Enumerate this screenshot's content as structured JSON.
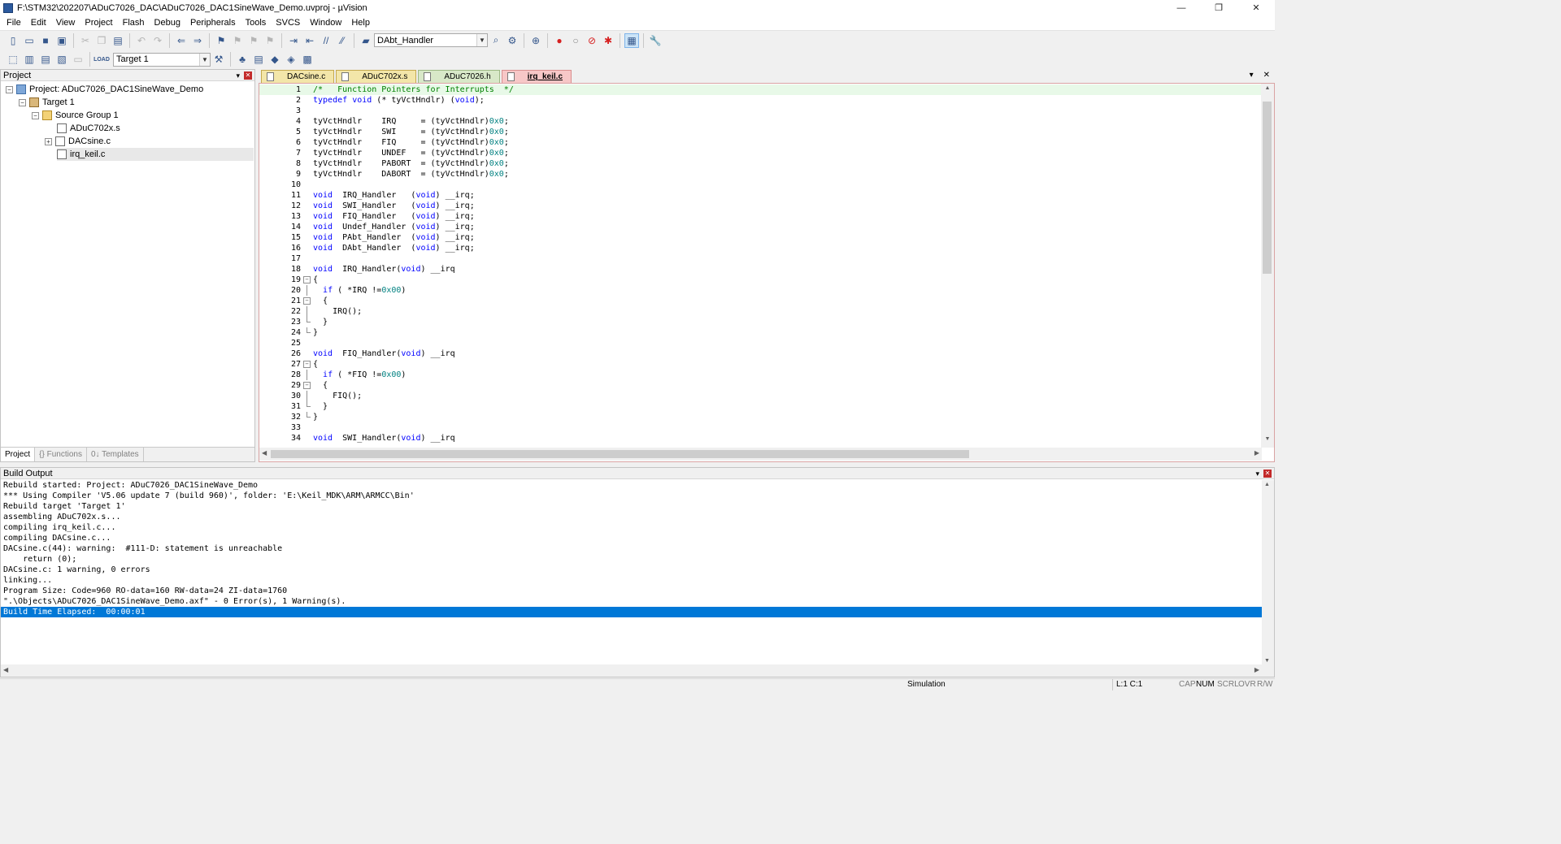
{
  "window": {
    "title": "F:\\STM32\\202207\\ADuC7026_DAC\\ADuC7026_DAC1SineWave_Demo.uvproj - µVision",
    "minimize": "—",
    "restore": "❐",
    "close": "✕"
  },
  "menu": [
    "File",
    "Edit",
    "View",
    "Project",
    "Flash",
    "Debug",
    "Peripherals",
    "Tools",
    "SVCS",
    "Window",
    "Help"
  ],
  "toolbar": {
    "function_combo": "DAbt_Handler",
    "target_combo": "Target 1",
    "load_label": "LOAD"
  },
  "project_panel": {
    "title": "Project",
    "pin": "▾",
    "close": "✕",
    "tree": [
      {
        "label": "Project: ADuC7026_DAC1SineWave_Demo",
        "icon": "project-icon",
        "expander": "−"
      },
      {
        "label": "Target 1",
        "icon": "target-icon",
        "expander": "−"
      },
      {
        "label": "Source Group 1",
        "icon": "folder-icon",
        "expander": "−"
      },
      {
        "label": "ADuC702x.s",
        "icon": "file-icon"
      },
      {
        "label": "DACsine.c",
        "icon": "file-icon",
        "expander": "+"
      },
      {
        "label": "irq_keil.c",
        "icon": "file-icon"
      }
    ],
    "tabs": [
      "Project",
      "{} Functions",
      "0↓ Templates"
    ]
  },
  "editor": {
    "tabs": [
      "DACsine.c",
      "ADuC702x.s",
      "ADuC7026.h",
      "irq_keil.c"
    ],
    "active_tab": "irq_keil.c",
    "tab_menu": "▾",
    "tab_close": "✕",
    "lines": [
      {
        "n": "1",
        "t": "/*   Function Pointers for Interrupts  */"
      },
      {
        "n": "2",
        "t": "typedef void (* tyVctHndlr) (void);"
      },
      {
        "n": "3",
        "t": ""
      },
      {
        "n": "4",
        "t": "tyVctHndlr    IRQ     = (tyVctHndlr)0x0;"
      },
      {
        "n": "5",
        "t": "tyVctHndlr    SWI     = (tyVctHndlr)0x0;"
      },
      {
        "n": "6",
        "t": "tyVctHndlr    FIQ     = (tyVctHndlr)0x0;"
      },
      {
        "n": "7",
        "t": "tyVctHndlr    UNDEF   = (tyVctHndlr)0x0;"
      },
      {
        "n": "8",
        "t": "tyVctHndlr    PABORT  = (tyVctHndlr)0x0;"
      },
      {
        "n": "9",
        "t": "tyVctHndlr    DABORT  = (tyVctHndlr)0x0;"
      },
      {
        "n": "10",
        "t": ""
      },
      {
        "n": "11",
        "t": "void  IRQ_Handler   (void) __irq;"
      },
      {
        "n": "12",
        "t": "void  SWI_Handler   (void) __irq;"
      },
      {
        "n": "13",
        "t": "void  FIQ_Handler   (void) __irq;"
      },
      {
        "n": "14",
        "t": "void  Undef_Handler (void) __irq;"
      },
      {
        "n": "15",
        "t": "void  PAbt_Handler  (void) __irq;"
      },
      {
        "n": "16",
        "t": "void  DAbt_Handler  (void) __irq;"
      },
      {
        "n": "17",
        "t": ""
      },
      {
        "n": "18",
        "t": "void  IRQ_Handler(void) __irq"
      },
      {
        "n": "19",
        "t": "{"
      },
      {
        "n": "20",
        "t": "  if ( *IRQ !=0x00)"
      },
      {
        "n": "21",
        "t": "  {"
      },
      {
        "n": "22",
        "t": "    IRQ();"
      },
      {
        "n": "23",
        "t": "  }"
      },
      {
        "n": "24",
        "t": "}"
      },
      {
        "n": "25",
        "t": ""
      },
      {
        "n": "26",
        "t": "void  FIQ_Handler(void) __irq"
      },
      {
        "n": "27",
        "t": "{"
      },
      {
        "n": "28",
        "t": "  if ( *FIQ !=0x00)"
      },
      {
        "n": "29",
        "t": "  {"
      },
      {
        "n": "30",
        "t": "    FIQ();"
      },
      {
        "n": "31",
        "t": "  }"
      },
      {
        "n": "32",
        "t": "}"
      },
      {
        "n": "33",
        "t": ""
      },
      {
        "n": "34",
        "t": "void  SWI_Handler(void) __irq"
      }
    ]
  },
  "build_output": {
    "title": "Build Output",
    "pin": "▾",
    "close": "✕",
    "lines": [
      "Rebuild started: Project: ADuC7026_DAC1SineWave_Demo",
      "*** Using Compiler 'V5.06 update 7 (build 960)', folder: 'E:\\Keil_MDK\\ARM\\ARMCC\\Bin'",
      "Rebuild target 'Target 1'",
      "assembling ADuC702x.s...",
      "compiling irq_keil.c...",
      "compiling DACsine.c...",
      "DACsine.c(44): warning:  #111-D: statement is unreachable",
      "    return (0);",
      "DACsine.c: 1 warning, 0 errors",
      "linking...",
      "Program Size: Code=960 RO-data=160 RW-data=24 ZI-data=1760",
      "\".\\Objects\\ADuC7026_DAC1SineWave_Demo.axf\" - 0 Error(s), 1 Warning(s).",
      "Build Time Elapsed:  00:00:01"
    ]
  },
  "status": {
    "mode": "Simulation",
    "cursor": "L:1 C:1",
    "cap": "CAP",
    "num": "NUM",
    "scrl": "SCRL",
    "ovr": "OVR",
    "rw": "R/W"
  }
}
